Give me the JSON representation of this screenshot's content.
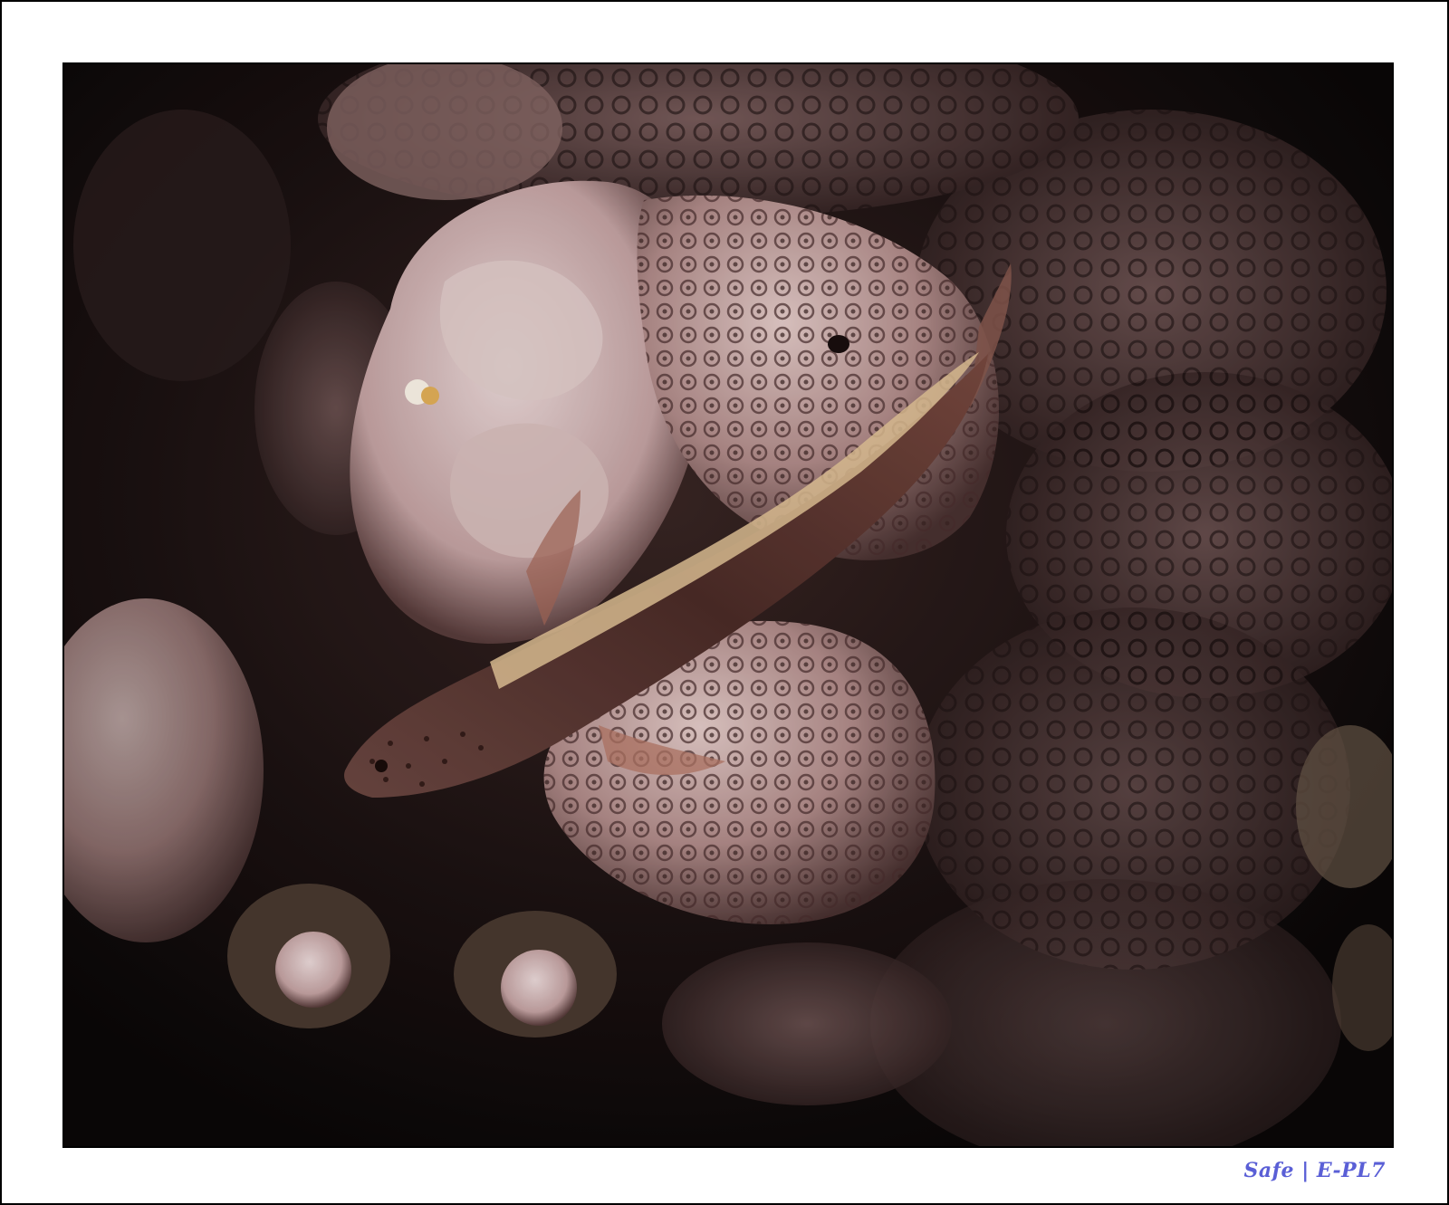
{
  "image": {
    "subject": "",
    "colors": {
      "background": "#ffffff",
      "border": "#000000",
      "caption": "#5a5fd6",
      "water": "#120c0c",
      "coral": "#c8a8a6",
      "fish": "#5a3430",
      "fish_stripe": "#e8c89a"
    }
  },
  "caption": {
    "text": "Safe | E-PL7"
  }
}
